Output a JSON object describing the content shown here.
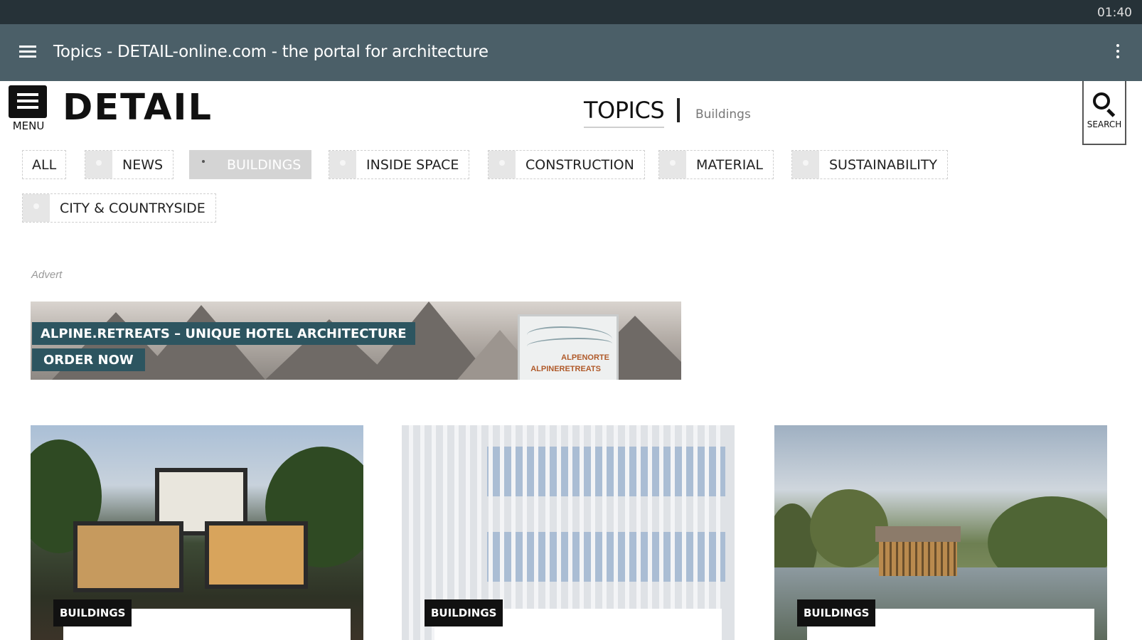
{
  "status_bar": {
    "time": "01:40"
  },
  "app_bar": {
    "title": "Topics - DETAIL-online.com - the portal for architecture"
  },
  "site_header": {
    "menu_label": "MENU",
    "logo_text": "DETAIL",
    "section_title": "TOPICS",
    "section_subtitle": "Buildings",
    "search_label": "SEARCH"
  },
  "filters": [
    {
      "label": "ALL",
      "has_check": false,
      "active": false
    },
    {
      "label": "NEWS",
      "has_check": true,
      "active": false
    },
    {
      "label": "BUILDINGS",
      "has_check": true,
      "active": true
    },
    {
      "label": "INSIDE SPACE",
      "has_check": true,
      "active": false
    },
    {
      "label": "CONSTRUCTION",
      "has_check": true,
      "active": false
    },
    {
      "label": "MATERIAL",
      "has_check": true,
      "active": false
    },
    {
      "label": "SUSTAINABILITY",
      "has_check": true,
      "active": false
    },
    {
      "label": "CITY & COUNTRYSIDE",
      "has_check": true,
      "active": false
    }
  ],
  "advert": {
    "label": "Advert",
    "headline": "ALPINE.RETREATS – UNIQUE HOTEL ARCHITECTURE",
    "cta": "ORDER NOW",
    "book_line1": "ALPENORTE",
    "book_line2": "ALPINERETREATS"
  },
  "cards": [
    {
      "badge": "BUILDINGS"
    },
    {
      "badge": "BUILDINGS"
    },
    {
      "badge": "BUILDINGS"
    }
  ],
  "colors": {
    "status_bar": "#263238",
    "app_bar": "#4b5f68",
    "advert_tag": "#2d5560",
    "active_chip": "#d4d4d4"
  }
}
